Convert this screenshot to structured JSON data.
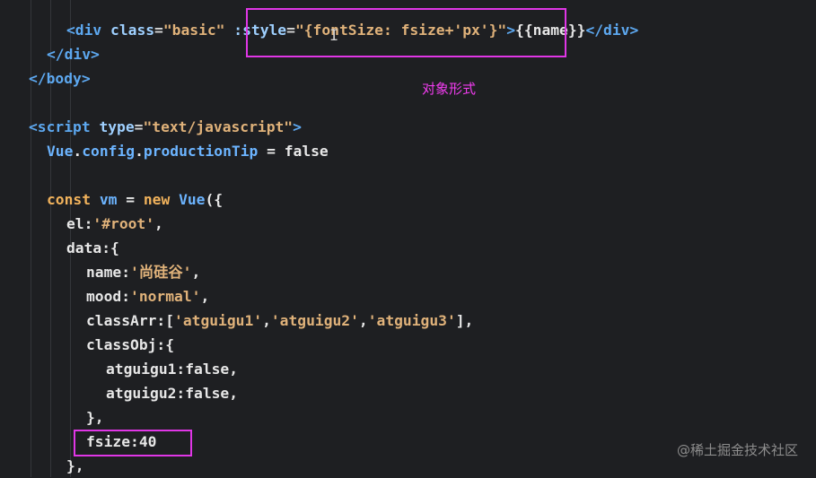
{
  "code": {
    "l1": {
      "open": "<div",
      "class_attr": "class",
      "eq": "=",
      "class_val": "\"basic\"",
      "style_attr": ":style",
      "eq2": "=",
      "q_open": "\"",
      "obj": "{fontSize: fsize+'px'}",
      "q_close": "\"",
      "gt": ">",
      "mustache": "{{name}}",
      "close": "</div>"
    },
    "l2": "</div>",
    "l3": "</body>",
    "l5": {
      "open": "<script",
      "attr": "type",
      "eq": "=",
      "val": "\"text/javascript\"",
      "gt": ">"
    },
    "l6": {
      "obj": "Vue",
      "dot1": ".",
      "prop1": "config",
      "dot2": ".",
      "prop2": "productionTip",
      "rest": " = false"
    },
    "l8": {
      "kw1": "const",
      "name": " vm ",
      "eq": "= ",
      "kw2": "new",
      "cls": " Vue",
      "rest": "({"
    },
    "l9": {
      "key": "el:",
      "val": "'#root'",
      "rest": ","
    },
    "l10": "data:{",
    "l11": {
      "key": "name:",
      "val": "'尚硅谷'",
      "rest": ","
    },
    "l12": {
      "key": "mood:",
      "val": "'normal'",
      "rest": ","
    },
    "l13": {
      "key": "classArr:[",
      "v1": "'atguigu1'",
      "c1": ",",
      "v2": "'atguigu2'",
      "c2": ",",
      "v3": "'atguigu3'",
      "rest": "],"
    },
    "l14": "classObj:{",
    "l15": "atguigu1:false,",
    "l16": "atguigu2:false,",
    "l17": "},",
    "l18": "fsize:40",
    "l19": "},"
  },
  "annotation": "对象形式",
  "watermark": "@稀土掘金技术社区",
  "colors": {
    "highlight": "#e036e6",
    "background": "#1e1f22"
  }
}
